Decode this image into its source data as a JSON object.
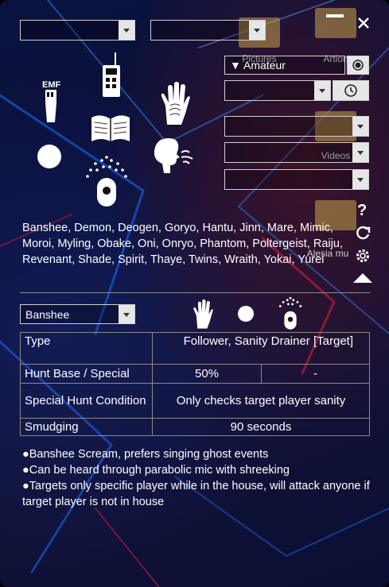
{
  "window": {
    "minimize_icon": "minimize-icon",
    "close_icon": "close-icon"
  },
  "filters": {
    "dropdown1": "",
    "dropdown2": ""
  },
  "desktop": {
    "pictures": "Pictures",
    "artion": "Artion",
    "videos": "Videos",
    "alesia": "Alesia mu"
  },
  "difficulty": {
    "selected": "Amateur",
    "marker": "▼"
  },
  "right_dropdowns": [
    "",
    "",
    "",
    ""
  ],
  "evidence_icons": [
    "emf-icon",
    "spirit-box-icon",
    "fingerprint-icon",
    "ghost-orb-icon",
    "ghost-writing-icon",
    "freezing-breath-icon",
    "dots-projector-icon"
  ],
  "ghost_list": "Banshee, Demon, Deogen, Goryo, Hantu, Jinn, Mare, Mimic, Moroi, Myling, Obake, Oni, Onryo, Phantom, Poltergeist, Raiju, Revenant, Shade, Spirit, Thaye, Twins, Wraith, Yokai, Yurei",
  "side_icons": [
    "help-icon",
    "reset-icon",
    "settings-icon",
    "collapse-icon"
  ],
  "selected_ghost": "Banshee",
  "details": {
    "type_label": "Type",
    "type_value": "Follower, Sanity Drainer [Target]",
    "hunt_label": "Hunt Base / Special",
    "hunt_base": "50%",
    "hunt_special": "-",
    "cond_label": "Special Hunt Condition",
    "cond_value": "Only checks target player sanity",
    "smudge_label": "Smudging",
    "smudge_value": "90 seconds"
  },
  "notes": [
    "●Banshee Scream, prefers singing ghost events",
    "●Can be heard through parabolic mic with shreeking",
    "●Targets only specific player while in the house, will attack anyone if target player is not in house"
  ],
  "colors": {
    "panel_bg": "#0b1240",
    "accent_red": "#c0182e",
    "line": "#8a8a8a"
  }
}
